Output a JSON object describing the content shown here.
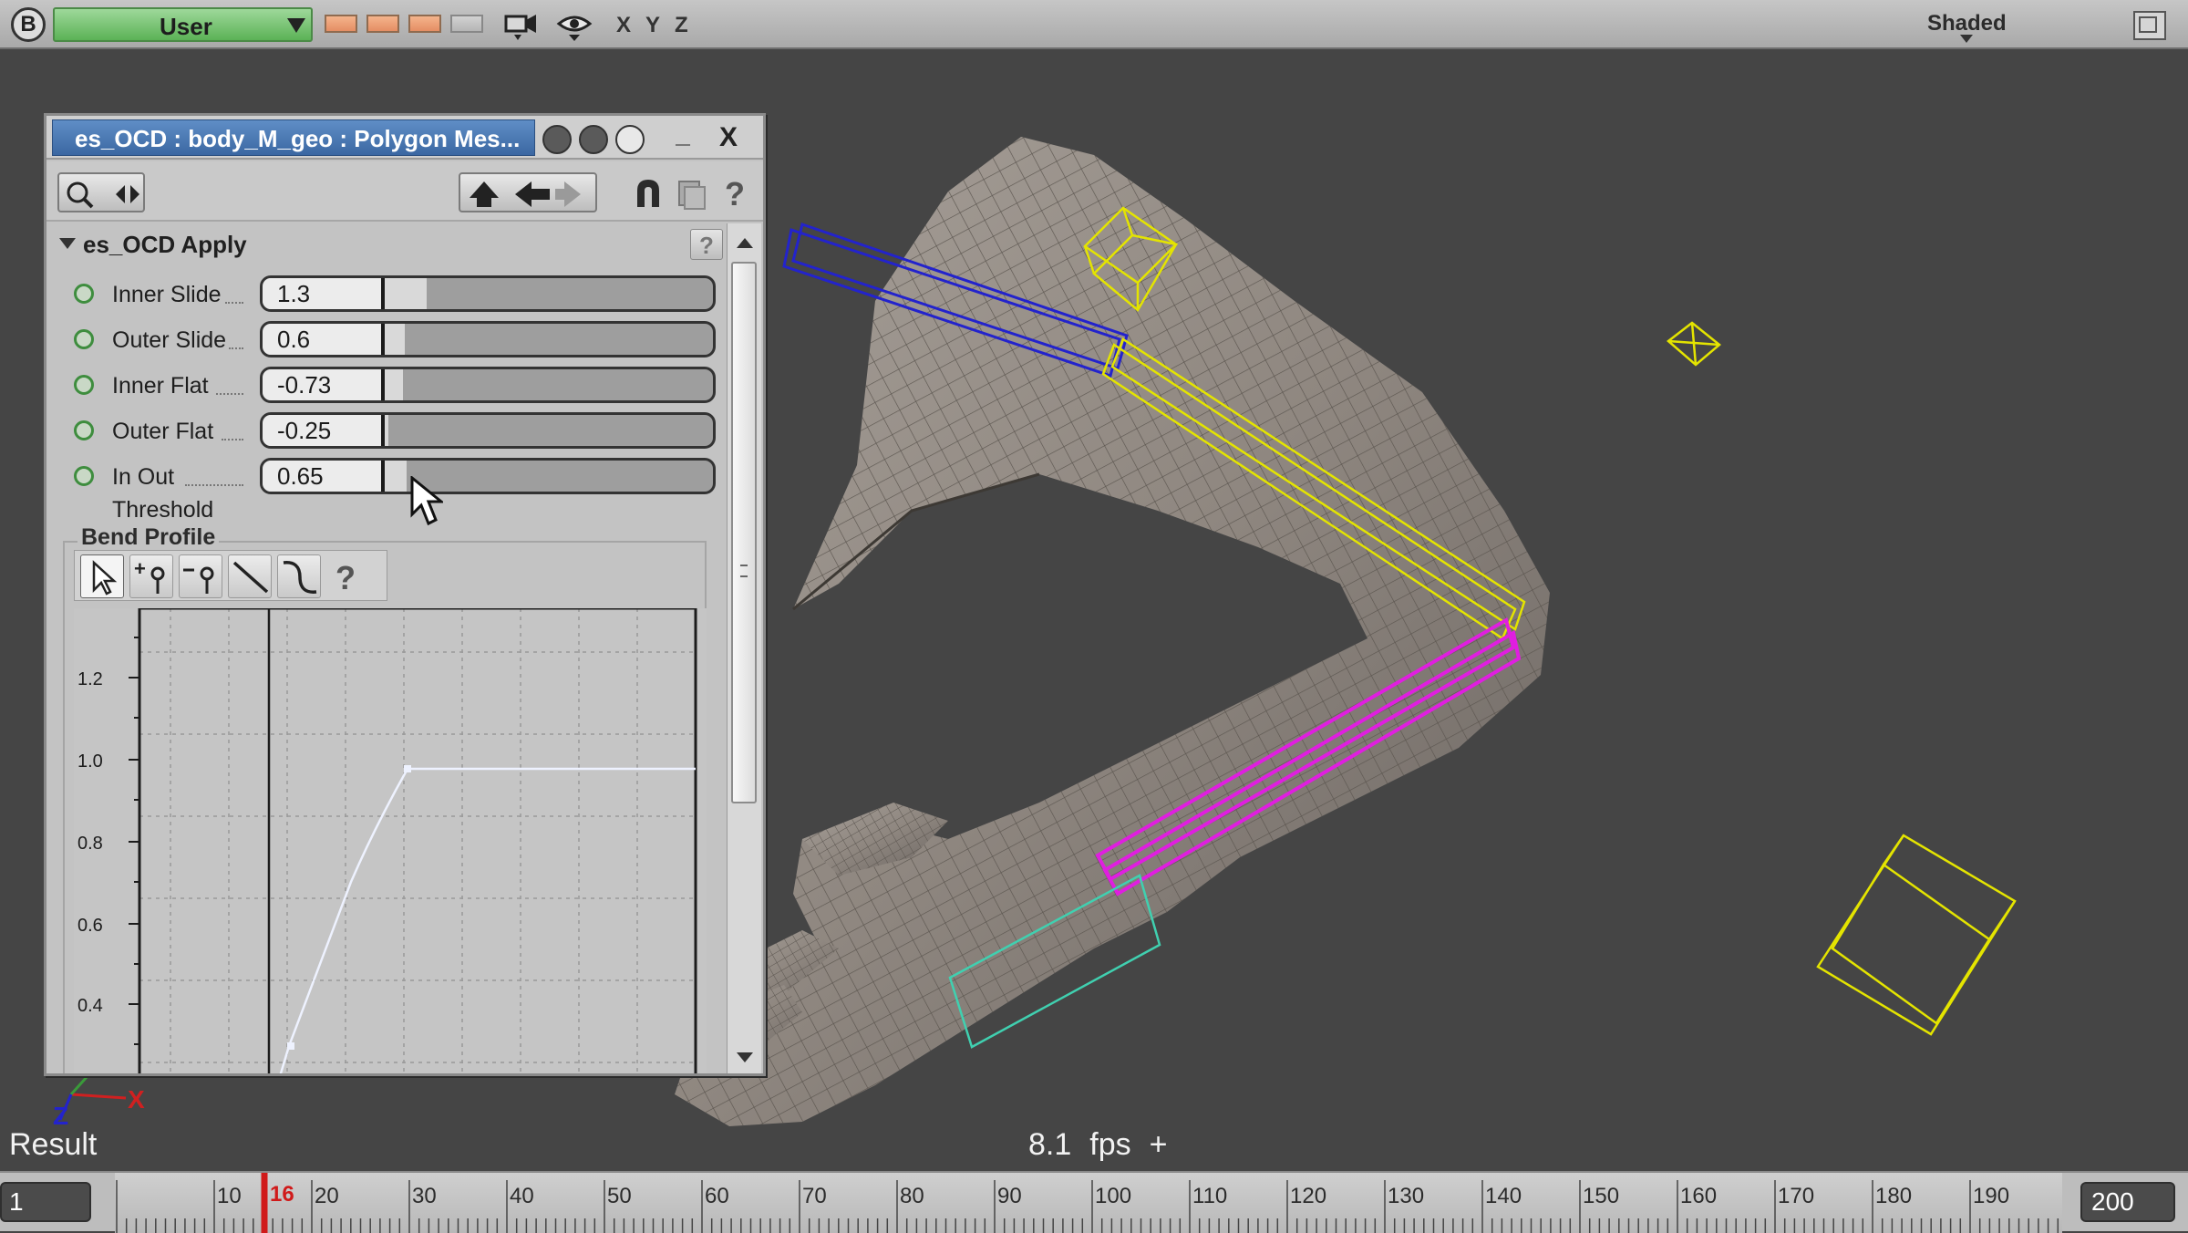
{
  "toolbar": {
    "logo": "B",
    "view_menu": "User",
    "axes": [
      "X",
      "Y",
      "Z"
    ],
    "display_mode": "Shaded"
  },
  "viewport": {
    "result_label": "Result",
    "fps_value": "8.1",
    "fps_unit": "fps",
    "fps_plus": "+",
    "axis_labels": {
      "x": "X",
      "z": "Z"
    }
  },
  "panel": {
    "title": "es_OCD : body_M_geo : Polygon Mes...",
    "minimize": "_",
    "close": "X",
    "section": "es_OCD Apply",
    "help": "?",
    "params": [
      {
        "label": "Inner Slide",
        "value": "1.3"
      },
      {
        "label": "Outer Slide",
        "value": "0.6"
      },
      {
        "label": "Inner Flat",
        "value": "-0.73"
      },
      {
        "label": "Outer Flat",
        "value": "-0.25"
      },
      {
        "label": "In Out",
        "label2": "Threshold",
        "value": "0.65"
      }
    ],
    "bend_profile": {
      "label": "Bend Profile",
      "help": "?",
      "y_ticks": [
        "1.2",
        "1.0",
        "0.8",
        "0.6",
        "0.4"
      ]
    }
  },
  "timeline": {
    "start": "1",
    "end": "200",
    "current": "16",
    "labels": [
      "10",
      "20",
      "30",
      "40",
      "50",
      "60",
      "70",
      "80",
      "90",
      "100",
      "110",
      "120",
      "130",
      "140",
      "150",
      "160",
      "170",
      "180",
      "190"
    ]
  },
  "colors": {
    "accent_green": "#5bb256",
    "title_blue": "#3b67a2",
    "mesh_grey": "#8f8780",
    "bone_yellow": "#e6e600",
    "bone_magenta": "#e01ee0",
    "bone_blue": "#2020d0",
    "bone_cyan": "#40d0b0",
    "frame_red": "#d01a1a"
  }
}
